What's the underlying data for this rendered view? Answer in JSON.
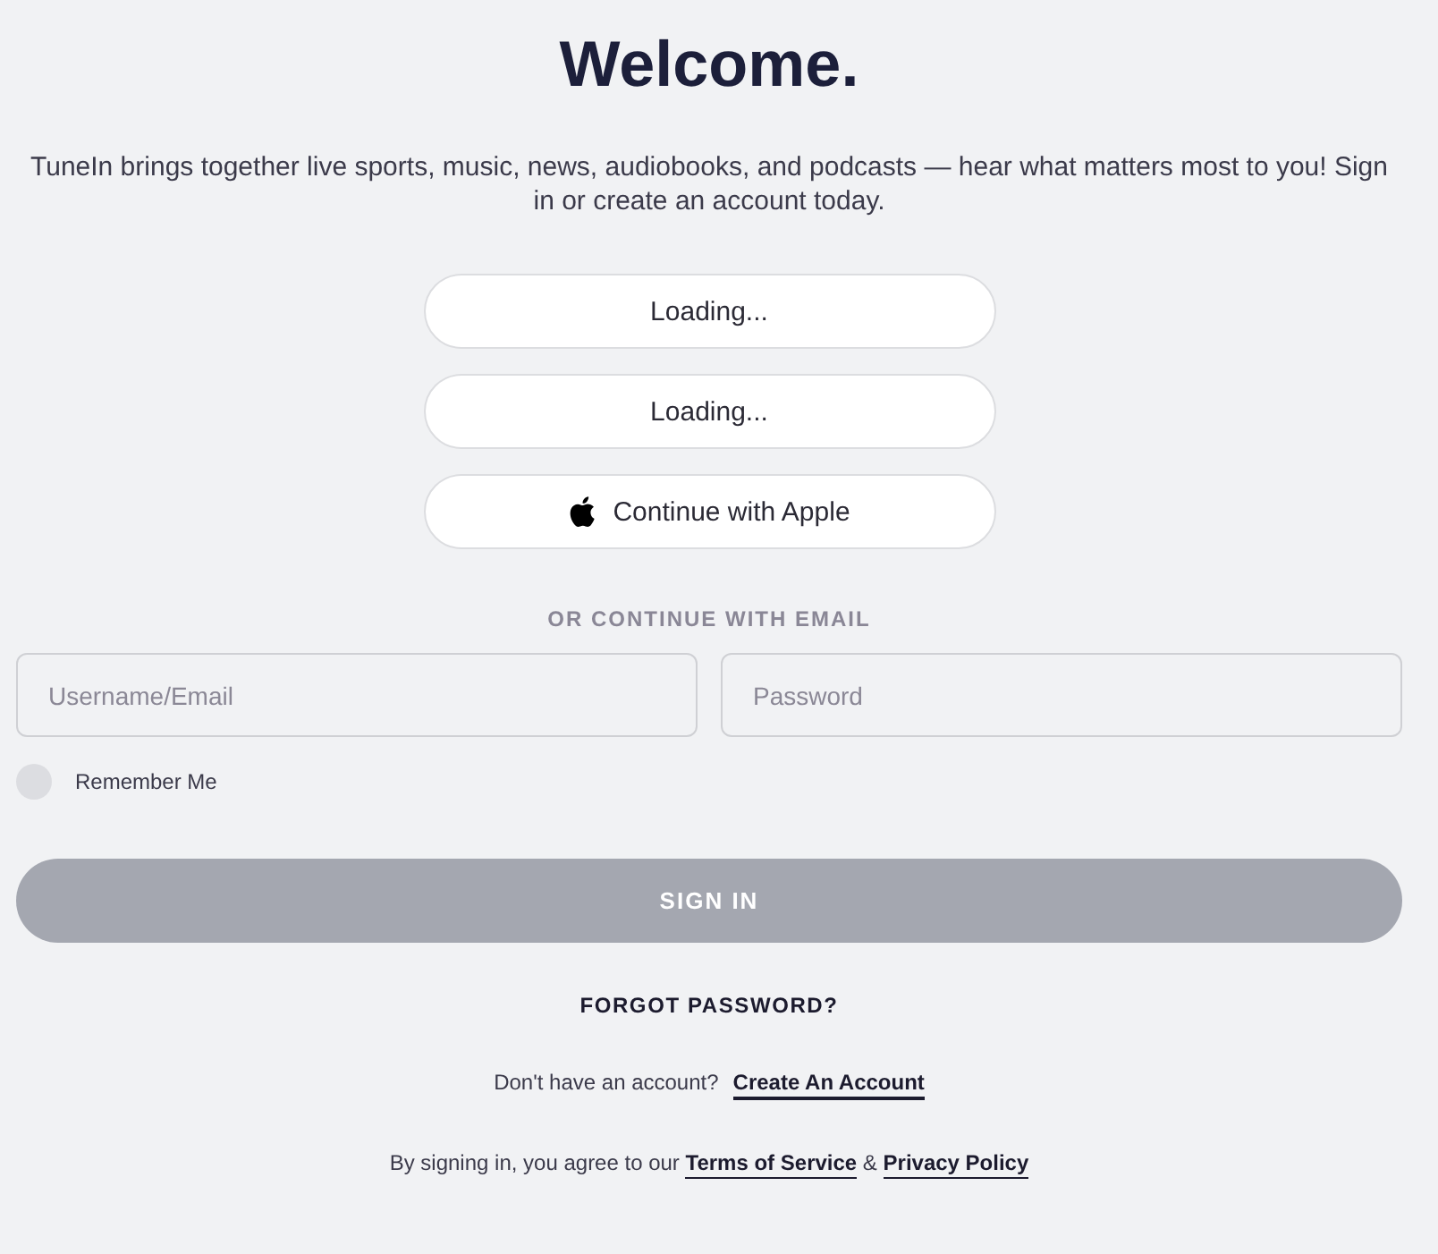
{
  "title": "Welcome.",
  "intro": "TuneIn brings together live sports, music, news, audiobooks, and podcasts — hear what matters most to you! Sign in or create an account today.",
  "social_buttons": [
    {
      "label": "Loading...",
      "kind": "loading"
    },
    {
      "label": "Loading...",
      "kind": "loading"
    },
    {
      "label": "Continue with Apple",
      "kind": "apple"
    }
  ],
  "divider_label": "OR CONTINUE WITH EMAIL",
  "fields": [
    {
      "placeholder": "Username/Email"
    },
    {
      "placeholder": "Password"
    }
  ],
  "remember_me": {
    "label": "Remember Me",
    "checked": false
  },
  "sign_in_button": {
    "label": "SIGN IN",
    "disabled": true
  },
  "forgot_password": "FORGOT PASSWORD?",
  "signup": {
    "prompt": "Don't have an account?",
    "link": "Create An Account"
  },
  "legal": {
    "text": "By signing in, you agree to our",
    "terms_link": "Terms of Service",
    "joiner": "&",
    "privacy_link": "Privacy Policy"
  }
}
